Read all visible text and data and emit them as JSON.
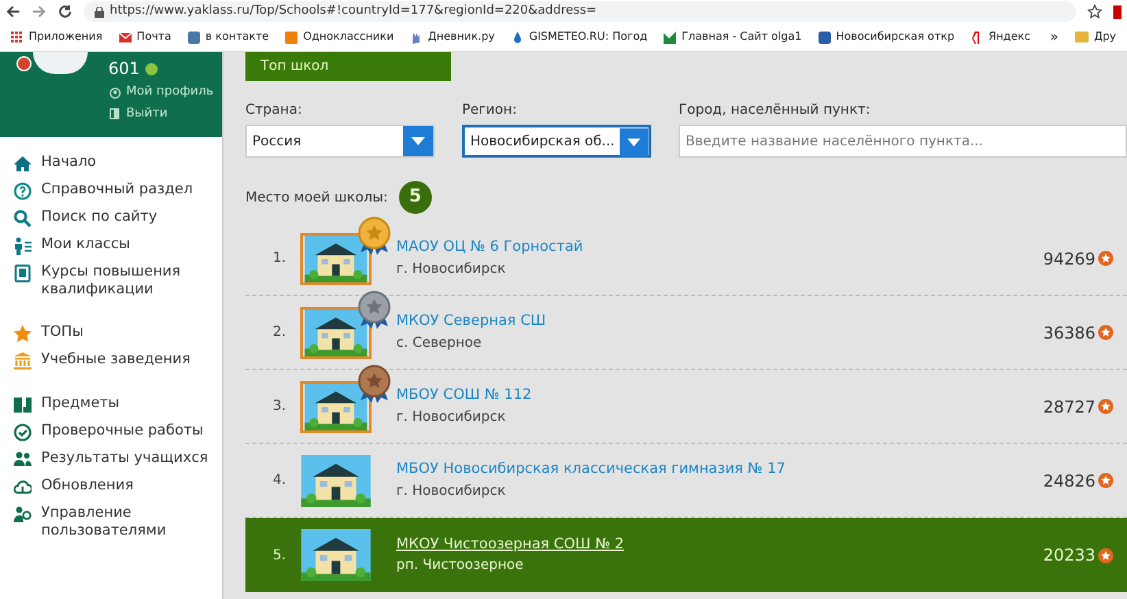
{
  "browser": {
    "url": "https://www.yaklass.ru/Top/Schools#!countryId=177&regionId=220&address=",
    "bookmarks": [
      "Приложения",
      "Почта",
      "в контакте",
      "Одноклассники",
      "Дневник.ру",
      "GISMETEO.RU: Погод",
      "Главная - Сайт olga1",
      "Новосибирская откр",
      "Яндекс"
    ],
    "overflow": "»",
    "other_bookmarks": "Дру"
  },
  "profile": {
    "points": "601",
    "links": [
      "Мой профиль",
      "Выйти"
    ]
  },
  "menu": [
    [
      "Начало",
      "Справочный раздел",
      "Поиск по сайту",
      "Мои классы",
      "Курсы повышения квалификации"
    ],
    [
      "ТОПы",
      "Учебные заведения"
    ],
    [
      "Предметы",
      "Проверочные работы",
      "Результаты учащихся",
      "Обновления",
      "Управление пользователями"
    ]
  ],
  "header": "Топ школ",
  "filters": [
    {
      "label": "Страна:",
      "value": "Россия",
      "kind": "select",
      "focused": false
    },
    {
      "label": "Регион:",
      "value": "Новосибирская об...",
      "kind": "select",
      "focused": true
    },
    {
      "label": "Город, населённый пункт:",
      "placeholder": "Введите название населённого пункта...",
      "kind": "text"
    }
  ],
  "my_place": {
    "label": "Место моей школы:",
    "value": "5"
  },
  "schools": [
    {
      "rank": "1.",
      "name": "МАОУ ОЦ № 6 Горностай",
      "town": "г. Новосибирск",
      "score": "94269",
      "kind": "gold",
      "selected": false
    },
    {
      "rank": "2.",
      "name": "МКОУ Северная СШ",
      "town": "с. Северное",
      "score": "36386",
      "kind": "silver",
      "selected": false
    },
    {
      "rank": "3.",
      "name": "МБОУ СОШ № 112",
      "town": "г. Новосибирск",
      "score": "28727",
      "kind": "bronze",
      "selected": false
    },
    {
      "rank": "4.",
      "name": "МБОУ Новосибирская классическая гимназия № 17",
      "town": "г. Новосибирск",
      "score": "24826",
      "kind": "plain",
      "selected": false
    },
    {
      "rank": "5.",
      "name": "МКОУ Чистоозерная СОШ № 2",
      "town": "рп. Чистоозерное",
      "score": "20233",
      "kind": "plain",
      "selected": true
    }
  ]
}
